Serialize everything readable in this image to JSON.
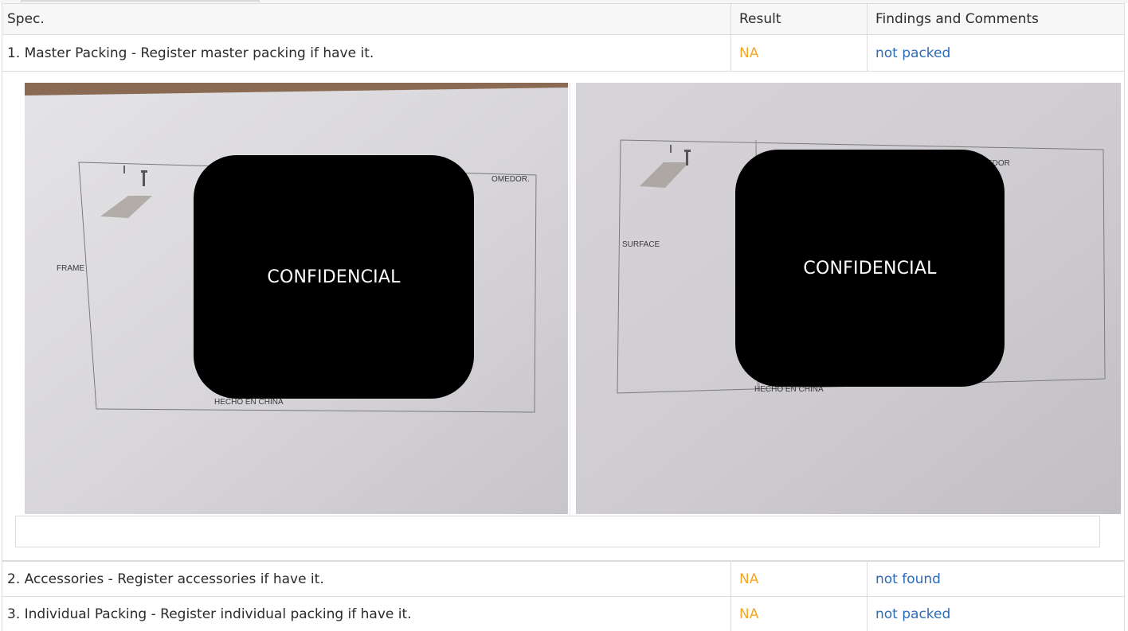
{
  "table": {
    "headers": {
      "spec": "Spec.",
      "result": "Result",
      "findings": "Findings and Comments"
    },
    "rows": [
      {
        "spec": "1. Master Packing - Register master packing if have it.",
        "result": "NA",
        "findings": "not packed"
      },
      {
        "spec": "2. Accessories - Register accessories if have it.",
        "result": "NA",
        "findings": "not found"
      },
      {
        "spec": "3. Individual Packing - Register individual packing if have it.",
        "result": "NA",
        "findings": "not packed"
      }
    ]
  },
  "photos": [
    {
      "label": "FRAME",
      "partial_title": "OMEDOR.",
      "origin": "HECHO EN CHINA",
      "overlay": "CONFIDENCIAL"
    },
    {
      "label": "SURFACE",
      "partial_title": "EDOR",
      "origin": "HECHO EN CHINA",
      "overlay": "CONFIDENCIAL"
    }
  ],
  "colors": {
    "result": "#f5a623",
    "findings": "#2c6cb6",
    "border": "#dcdcdc"
  }
}
